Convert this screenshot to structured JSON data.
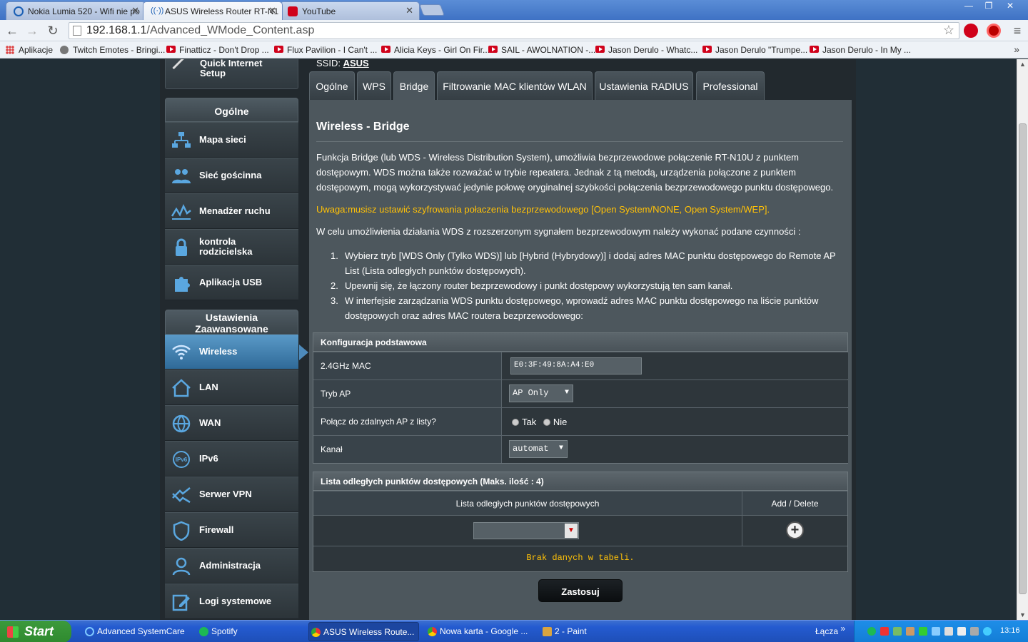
{
  "browser": {
    "tabs": [
      {
        "title": "Nokia Lumia 520 - Wifi nie po",
        "active": false
      },
      {
        "title": "ASUS Wireless Router RT-N1",
        "active": true
      },
      {
        "title": "YouTube",
        "active": false
      }
    ],
    "url_host": "192.168.1.1",
    "url_path": "/Advanced_WMode_Content.asp",
    "bookmarks": [
      {
        "label": "Aplikacje",
        "icon": "apps-grid-icon"
      },
      {
        "label": "Twitch Emotes - Bringi...",
        "icon": "twitch-icon"
      },
      {
        "label": "Finatticz - Don't Drop ...",
        "icon": "youtube-icon"
      },
      {
        "label": "Flux Pavilion - I Can't ...",
        "icon": "youtube-icon"
      },
      {
        "label": "Alicia Keys - Girl On Fir...",
        "icon": "youtube-icon"
      },
      {
        "label": "SAIL - AWOLNATION -...",
        "icon": "youtube-icon"
      },
      {
        "label": "Jason Derulo - Whatc...",
        "icon": "youtube-icon"
      },
      {
        "label": "Jason Derulo \"Trumpe...",
        "icon": "youtube-icon"
      },
      {
        "label": "Jason Derulo - In My ...",
        "icon": "youtube-icon"
      }
    ],
    "bookmarks_more": "»"
  },
  "router": {
    "ssid_label": "SSID:",
    "ssid_value": "ASUS",
    "quick_setup": "Quick Internet Setup",
    "general_header": "Ogólne",
    "general_items": [
      {
        "label": "Mapa sieci",
        "icon": "network-map-icon"
      },
      {
        "label": "Sieć gościnna",
        "icon": "guest-network-icon"
      },
      {
        "label": "Menadżer ruchu",
        "icon": "traffic-manager-icon"
      },
      {
        "label": "kontrola rodzicielska",
        "icon": "lock-icon"
      },
      {
        "label": "Aplikacja USB",
        "icon": "puzzle-icon"
      }
    ],
    "advanced_header": "Ustawienia Zaawansowane",
    "advanced_items": [
      {
        "label": "Wireless",
        "icon": "wifi-icon",
        "active": true
      },
      {
        "label": "LAN",
        "icon": "home-icon"
      },
      {
        "label": "WAN",
        "icon": "globe-icon"
      },
      {
        "label": "IPv6",
        "icon": "ipv6-icon"
      },
      {
        "label": "Serwer VPN",
        "icon": "vpn-icon"
      },
      {
        "label": "Firewall",
        "icon": "shield-icon"
      },
      {
        "label": "Administracja",
        "icon": "user-icon"
      },
      {
        "label": "Logi systemowe",
        "icon": "log-edit-icon"
      }
    ],
    "subtabs": [
      "Ogólne",
      "WPS",
      "Bridge",
      "Filtrowanie MAC klientów WLAN",
      "Ustawienia RADIUS",
      "Professional"
    ],
    "active_subtab": "Bridge",
    "page_title": "Wireless - Bridge",
    "description": "Funkcja Bridge (lub WDS - Wireless Distribution System), umożliwia bezprzewodowe połączenie RT-N10U z punktem dostępowym. WDS można także rozważać w trybie repeatera. Jednak z tą metodą, urządzenia połączone z punktem dostępowym, mogą wykorzystywać jedynie połowę oryginalnej szybkości połączenia bezprzewodowego punktu dostępowego.",
    "warning": "Uwaga:musisz ustawić szyfrowania połaczenia bezprzewodowego [Open System/NONE, Open System/WEP].",
    "intro": "W celu umożliwienia działania WDS z rozszerzonym sygnałem bezprzewodowym należy wykonać podane czynności :",
    "steps": [
      "Wybierz tryb [WDS Only (Tylko WDS)] lub [Hybrid (Hybrydowy)] i dodaj adres MAC punktu dostępowego do Remote AP List (Lista odległych punktów dostępowych).",
      "Upewnij się, że łączony router bezprzewodowy i punkt dostępowy wykorzystują ten sam kanał.",
      "W interfejsie zarządzania WDS punktu dostępowego, wprowadź adres MAC punktu dostępowego na liście punktów dostępowych oraz adres MAC routera bezprzewodowego:"
    ],
    "config": {
      "header": "Konfiguracja podstawowa",
      "mac_label": "2.4GHz MAC",
      "mac_value": "E0:3F:49:8A:A4:E0",
      "ap_mode_label": "Tryb AP",
      "ap_mode_value": "AP Only",
      "connect_label": "Połącz do zdalnych AP z listy?",
      "yes": "Tak",
      "no": "Nie",
      "channel_label": "Kanał",
      "channel_value": "automat"
    },
    "remote_list": {
      "header": "Lista odległych punktów dostępowych (Maks. ilość : 4)",
      "col_list": "Lista odległych punktów dostępowych",
      "col_action": "Add / Delete",
      "empty": "Brak danych w tabeli."
    },
    "apply": "Zastosuj"
  },
  "taskbar": {
    "start": "Start",
    "tasks": [
      {
        "label": "Advanced SystemCare",
        "active": false
      },
      {
        "label": "Spotify",
        "active": false
      },
      {
        "label": "ASUS Wireless Route...",
        "active": true
      },
      {
        "label": "Nowa karta - Google ...",
        "active": false
      },
      {
        "label": "2 - Paint",
        "active": false
      }
    ],
    "links_label": "Łącza",
    "links_more": "»",
    "clock": "13:16"
  }
}
